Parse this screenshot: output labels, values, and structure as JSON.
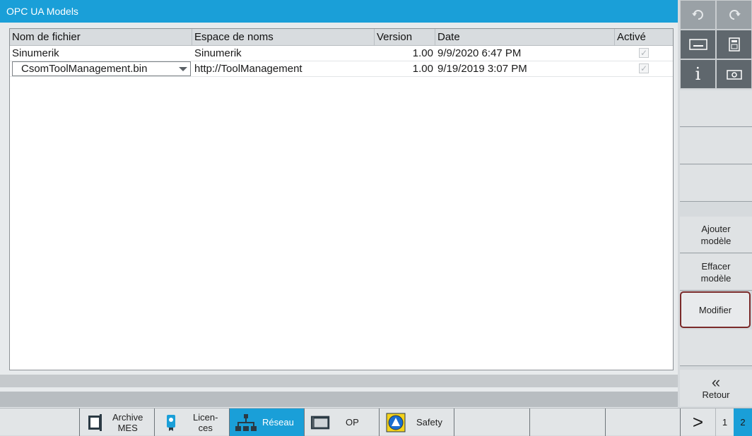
{
  "window": {
    "title": "OPC UA Models"
  },
  "table": {
    "headers": [
      "Nom de fichier",
      "Espace de noms",
      "Version",
      "Date",
      "Activé"
    ],
    "rows": [
      {
        "filename": "Sinumerik",
        "namespace": "Sinumerik",
        "version": "1.00",
        "date": "9/9/2020 6:47 PM",
        "active": true
      },
      {
        "filename": "CsomToolManagement.bin",
        "namespace": "http://ToolManagement",
        "version": "1.00",
        "date": "9/19/2019 3:07 PM",
        "active": true
      }
    ]
  },
  "softkeys": {
    "add_model": [
      "Ajouter",
      "modèle"
    ],
    "delete_model": [
      "Effacer",
      "modèle"
    ],
    "modify": "Modifier",
    "back_arrow": "«",
    "back": "Retour"
  },
  "topicons": [
    "undo-icon",
    "redo-icon",
    "keyboard-icon",
    "calculator-icon",
    "info-icon",
    "camera-icon"
  ],
  "bottombar": {
    "items": [
      {
        "label": [
          "Archive",
          "MES"
        ],
        "icon": "archive-icon",
        "active": false
      },
      {
        "label": [
          "Licen-",
          "ces"
        ],
        "icon": "license-icon",
        "active": false
      },
      {
        "label": [
          "Réseau"
        ],
        "icon": "network-icon",
        "active": true
      },
      {
        "label": [
          "OP"
        ],
        "icon": "op-icon",
        "active": false
      },
      {
        "label": [
          "Safety"
        ],
        "icon": "safety-icon",
        "active": false
      }
    ],
    "next": ">",
    "pages": [
      "1",
      "2"
    ]
  },
  "colors": {
    "accent": "#1a9fd8",
    "selected_border": "#7a2a2a"
  }
}
